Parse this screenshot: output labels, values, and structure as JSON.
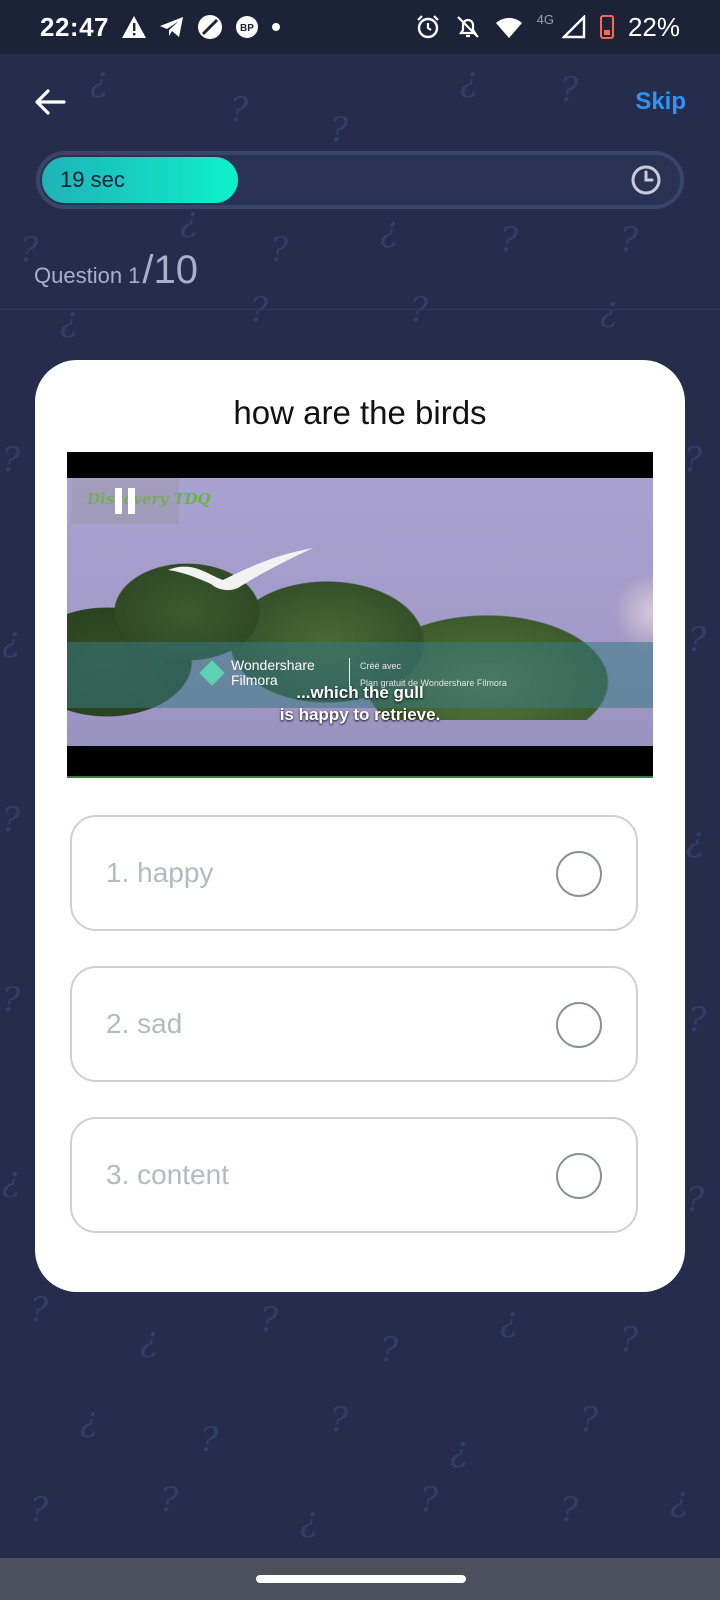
{
  "status_bar": {
    "time": "22:47",
    "network": "4G",
    "battery": "22%",
    "left_icons": [
      "warning-icon",
      "telegram-icon",
      "no-sim-icon",
      "bp-icon",
      "dot-icon"
    ],
    "bp_badge": "BP",
    "right_icons": [
      "alarm-icon",
      "bell-off-icon",
      "wifi-icon",
      "signal-icon",
      "battery-low-icon"
    ]
  },
  "header": {
    "back_icon": "arrow-left-icon",
    "skip_label": "Skip"
  },
  "timer": {
    "label": "19 sec",
    "progress_percent": 31,
    "icon": "clock-icon"
  },
  "question": {
    "counter_prefix": "Question 1",
    "counter_total": "/10",
    "title": "how are the birds"
  },
  "video": {
    "channel_text": "Discovery TDQ",
    "watermark_brand_line1": "Wondershare",
    "watermark_brand_line2": "Filmora",
    "watermark_sub_line1": "Créé avec",
    "watermark_sub_line2": "Plan gratuit de Wondershare Filmora",
    "caption_line1": "...which the gull",
    "caption_line2": "is happy to retrieve.",
    "state_icon": "pause-icon"
  },
  "options": [
    {
      "label": "1. happy",
      "selected": false
    },
    {
      "label": "2. sad",
      "selected": false
    },
    {
      "label": "3. content",
      "selected": false
    }
  ],
  "colors": {
    "background": "#262d4c",
    "accent": "#2f93f5",
    "timer_fill": "#0ef0c9"
  }
}
